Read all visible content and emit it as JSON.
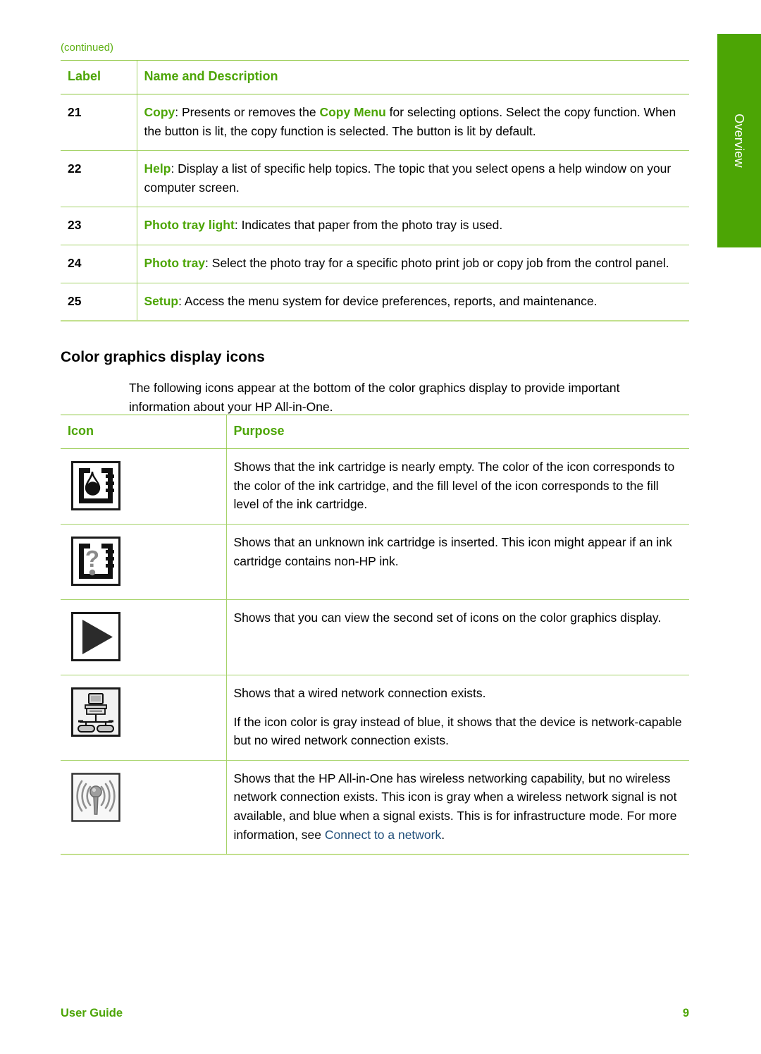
{
  "side_tab": {
    "label": "Overview"
  },
  "continued_note": "(continued)",
  "colors": {
    "accent_green": "#4CA505",
    "rule_green": "#8DC63F",
    "link_blue": "#1F4E79",
    "tab_green": "#4CA505"
  },
  "controls_table": {
    "headers": {
      "label": "Label",
      "name_and_description": "Name and Description"
    },
    "rows": [
      {
        "label": "21",
        "term": "Copy",
        "term_sep": ": ",
        "text_before_inline": "Presents or removes the ",
        "inline_term": "Copy Menu",
        "text_after_inline": " for selecting options. Select the copy function. When the button is lit, the copy function is selected. The button is lit by default."
      },
      {
        "label": "22",
        "term": "Help",
        "term_sep": ": ",
        "text": "Display a list of specific help topics. The topic that you select opens a help window on your computer screen."
      },
      {
        "label": "23",
        "term": "Photo tray light",
        "term_sep": ": ",
        "text": "Indicates that paper from the photo tray is used."
      },
      {
        "label": "24",
        "term": "Photo tray",
        "term_sep": ": ",
        "text": "Select the photo tray for a specific photo print job or copy job from the control panel."
      },
      {
        "label": "25",
        "term": "Setup",
        "term_sep": ": ",
        "text": "Access the menu system for device preferences, reports, and maintenance."
      }
    ]
  },
  "section": {
    "heading": "Color graphics display icons",
    "intro": "The following icons appear at the bottom of the color graphics display to provide important information about your HP All-in-One."
  },
  "icons_table": {
    "headers": {
      "icon": "Icon",
      "purpose": "Purpose"
    },
    "rows": [
      {
        "icon_name": "ink-level-cartridge-icon",
        "purpose": "Shows that the ink cartridge is nearly empty. The color of the icon corresponds to the color of the ink cartridge, and the fill level of the icon corresponds to the fill level of the ink cartridge."
      },
      {
        "icon_name": "unknown-ink-cartridge-icon",
        "purpose": "Shows that an unknown ink cartridge is inserted. This icon might appear if an ink cartridge contains non-HP ink."
      },
      {
        "icon_name": "right-arrow-icon",
        "purpose": "Shows that you can view the second set of icons on the color graphics display."
      },
      {
        "icon_name": "wired-network-icon",
        "purpose_line_1": "Shows that a wired network connection exists.",
        "purpose_line_2": "If the icon color is gray instead of blue, it shows that the device is network-capable but no wired network connection exists."
      },
      {
        "icon_name": "wireless-network-icon",
        "purpose_before_link": "Shows that the HP All-in-One has wireless networking capability, but no wireless network connection exists. This icon is gray when a wireless network signal is not available, and blue when a signal exists. This is for infrastructure mode. For more information, see ",
        "purpose_link": "Connect to a network",
        "purpose_after_link": "."
      }
    ]
  },
  "footer": {
    "left": "User Guide",
    "page_number": "9"
  }
}
